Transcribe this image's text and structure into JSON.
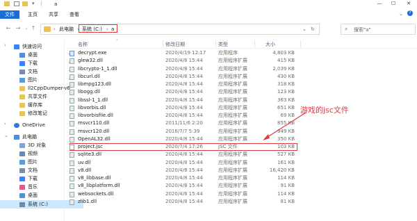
{
  "window": {
    "title": "a",
    "controls": [
      "—",
      "☐",
      "✕"
    ]
  },
  "ribbon": {
    "tabs": [
      "文件",
      "主页",
      "共享",
      "查看"
    ]
  },
  "address": {
    "crumbs": [
      "此电脑",
      "系统 (C:)",
      "a"
    ],
    "search_placeholder": "搜索\"a\""
  },
  "sidebar": {
    "items": [
      {
        "label": "快速访问",
        "icon": "star-icon"
      },
      {
        "label": "桌面",
        "icon": "desktop-icon"
      },
      {
        "label": "下载",
        "icon": "download-icon"
      },
      {
        "label": "文档",
        "icon": "document-icon"
      },
      {
        "label": "图片",
        "icon": "pictures-icon"
      },
      {
        "label": "Il2CppDumper-v6",
        "icon": "folder-icon"
      },
      {
        "label": "共享文件",
        "icon": "folder-icon"
      },
      {
        "label": "缓存库",
        "icon": "folder-icon"
      },
      {
        "label": "修改笔记",
        "icon": "folder-icon"
      },
      {
        "label": "OneDrive",
        "icon": "cloud-icon"
      },
      {
        "label": "此电脑",
        "icon": "computer-icon"
      },
      {
        "label": "3D 对象",
        "icon": "cube-icon"
      },
      {
        "label": "视频",
        "icon": "video-icon"
      },
      {
        "label": "图片",
        "icon": "pictures-icon"
      },
      {
        "label": "文档",
        "icon": "document-icon"
      },
      {
        "label": "下载",
        "icon": "download-icon"
      },
      {
        "label": "音乐",
        "icon": "music-icon"
      },
      {
        "label": "桌面",
        "icon": "desktop-icon"
      },
      {
        "label": "系统 (C:)",
        "icon": "drive-icon"
      }
    ]
  },
  "columns": {
    "name": "名称",
    "date": "修改日期",
    "type": "类型",
    "size": "大小"
  },
  "files": [
    {
      "name": "decrypt.exe",
      "date": "2020/4/19 12:17",
      "type": "应用程序",
      "size": "4,803 KB",
      "icon": "exe"
    },
    {
      "name": "glew32.dll",
      "date": "2020/4/8 15:44",
      "type": "应用程序扩展",
      "size": "415 KB",
      "icon": "dll"
    },
    {
      "name": "libcrypto-1_1.dll",
      "date": "2020/4/8 15:44",
      "type": "应用程序扩展",
      "size": "2,039 KB",
      "icon": "dll"
    },
    {
      "name": "libcurl.dll",
      "date": "2020/4/8 15:44",
      "type": "应用程序扩展",
      "size": "430 KB",
      "icon": "dll"
    },
    {
      "name": "libmpg123.dll",
      "date": "2020/4/8 15:44",
      "type": "应用程序扩展",
      "size": "318 KB",
      "icon": "dll"
    },
    {
      "name": "libogg.dll",
      "date": "2020/4/8 15:44",
      "type": "应用程序扩展",
      "size": "123 KB",
      "icon": "dll"
    },
    {
      "name": "libssl-1_1.dll",
      "date": "2020/4/8 15:44",
      "type": "应用程序扩展",
      "size": "363 KB",
      "icon": "dll"
    },
    {
      "name": "libvorbis.dll",
      "date": "2020/4/8 15:44",
      "type": "应用程序扩展",
      "size": "651 KB",
      "icon": "dll"
    },
    {
      "name": "libvorbisfile.dll",
      "date": "2020/4/8 15:44",
      "type": "应用程序扩展",
      "size": "69 KB",
      "icon": "dll"
    },
    {
      "name": "msvcr110.dll",
      "date": "2011/11/6 2:20",
      "type": "应用程序扩展",
      "size": "855 KB",
      "icon": "dll"
    },
    {
      "name": "msvcr120.dll",
      "date": "2016/7/7 5:39",
      "type": "应用程序扩展",
      "size": "949 KB",
      "icon": "dll"
    },
    {
      "name": "OpenAL32.dll",
      "date": "2020/4/8 15:44",
      "type": "应用程序扩展",
      "size": "350 KB",
      "icon": "dll"
    },
    {
      "name": "project.jsc",
      "date": "2020/7/4 17:26",
      "type": "JSC 文件",
      "size": "103 KB",
      "icon": "js",
      "highlight": true
    },
    {
      "name": "sqlite3.dll",
      "date": "2020/4/8 15:44",
      "type": "应用程序扩展",
      "size": "527 KB",
      "icon": "dll"
    },
    {
      "name": "uv.dll",
      "date": "2020/4/8 15:44",
      "type": "应用程序扩展",
      "size": "161 KB",
      "icon": "dll"
    },
    {
      "name": "v8.dll",
      "date": "2020/4/8 15:44",
      "type": "应用程序扩展",
      "size": "16,420 KB",
      "icon": "dll"
    },
    {
      "name": "v8_libbase.dll",
      "date": "2020/4/8 15:44",
      "type": "应用程序扩展",
      "size": "114 KB",
      "icon": "dll"
    },
    {
      "name": "v8_libplatform.dll",
      "date": "2020/4/8 15:44",
      "type": "应用程序扩展",
      "size": "91 KB",
      "icon": "dll"
    },
    {
      "name": "websockets.dll",
      "date": "2020/4/8 15:44",
      "type": "应用程序扩展",
      "size": "114 KB",
      "icon": "dll"
    },
    {
      "name": "zlib1.dll",
      "date": "2020/4/8 15:44",
      "type": "应用程序扩展",
      "size": "81 KB",
      "icon": "dll"
    }
  ],
  "annotation": {
    "text": "游戏的jsc文件",
    "color": "#e0393e"
  },
  "colors": {
    "accent": "#1a6fd6",
    "highlight_red": "#e0393e",
    "selected_bg": "#cce8ff"
  }
}
